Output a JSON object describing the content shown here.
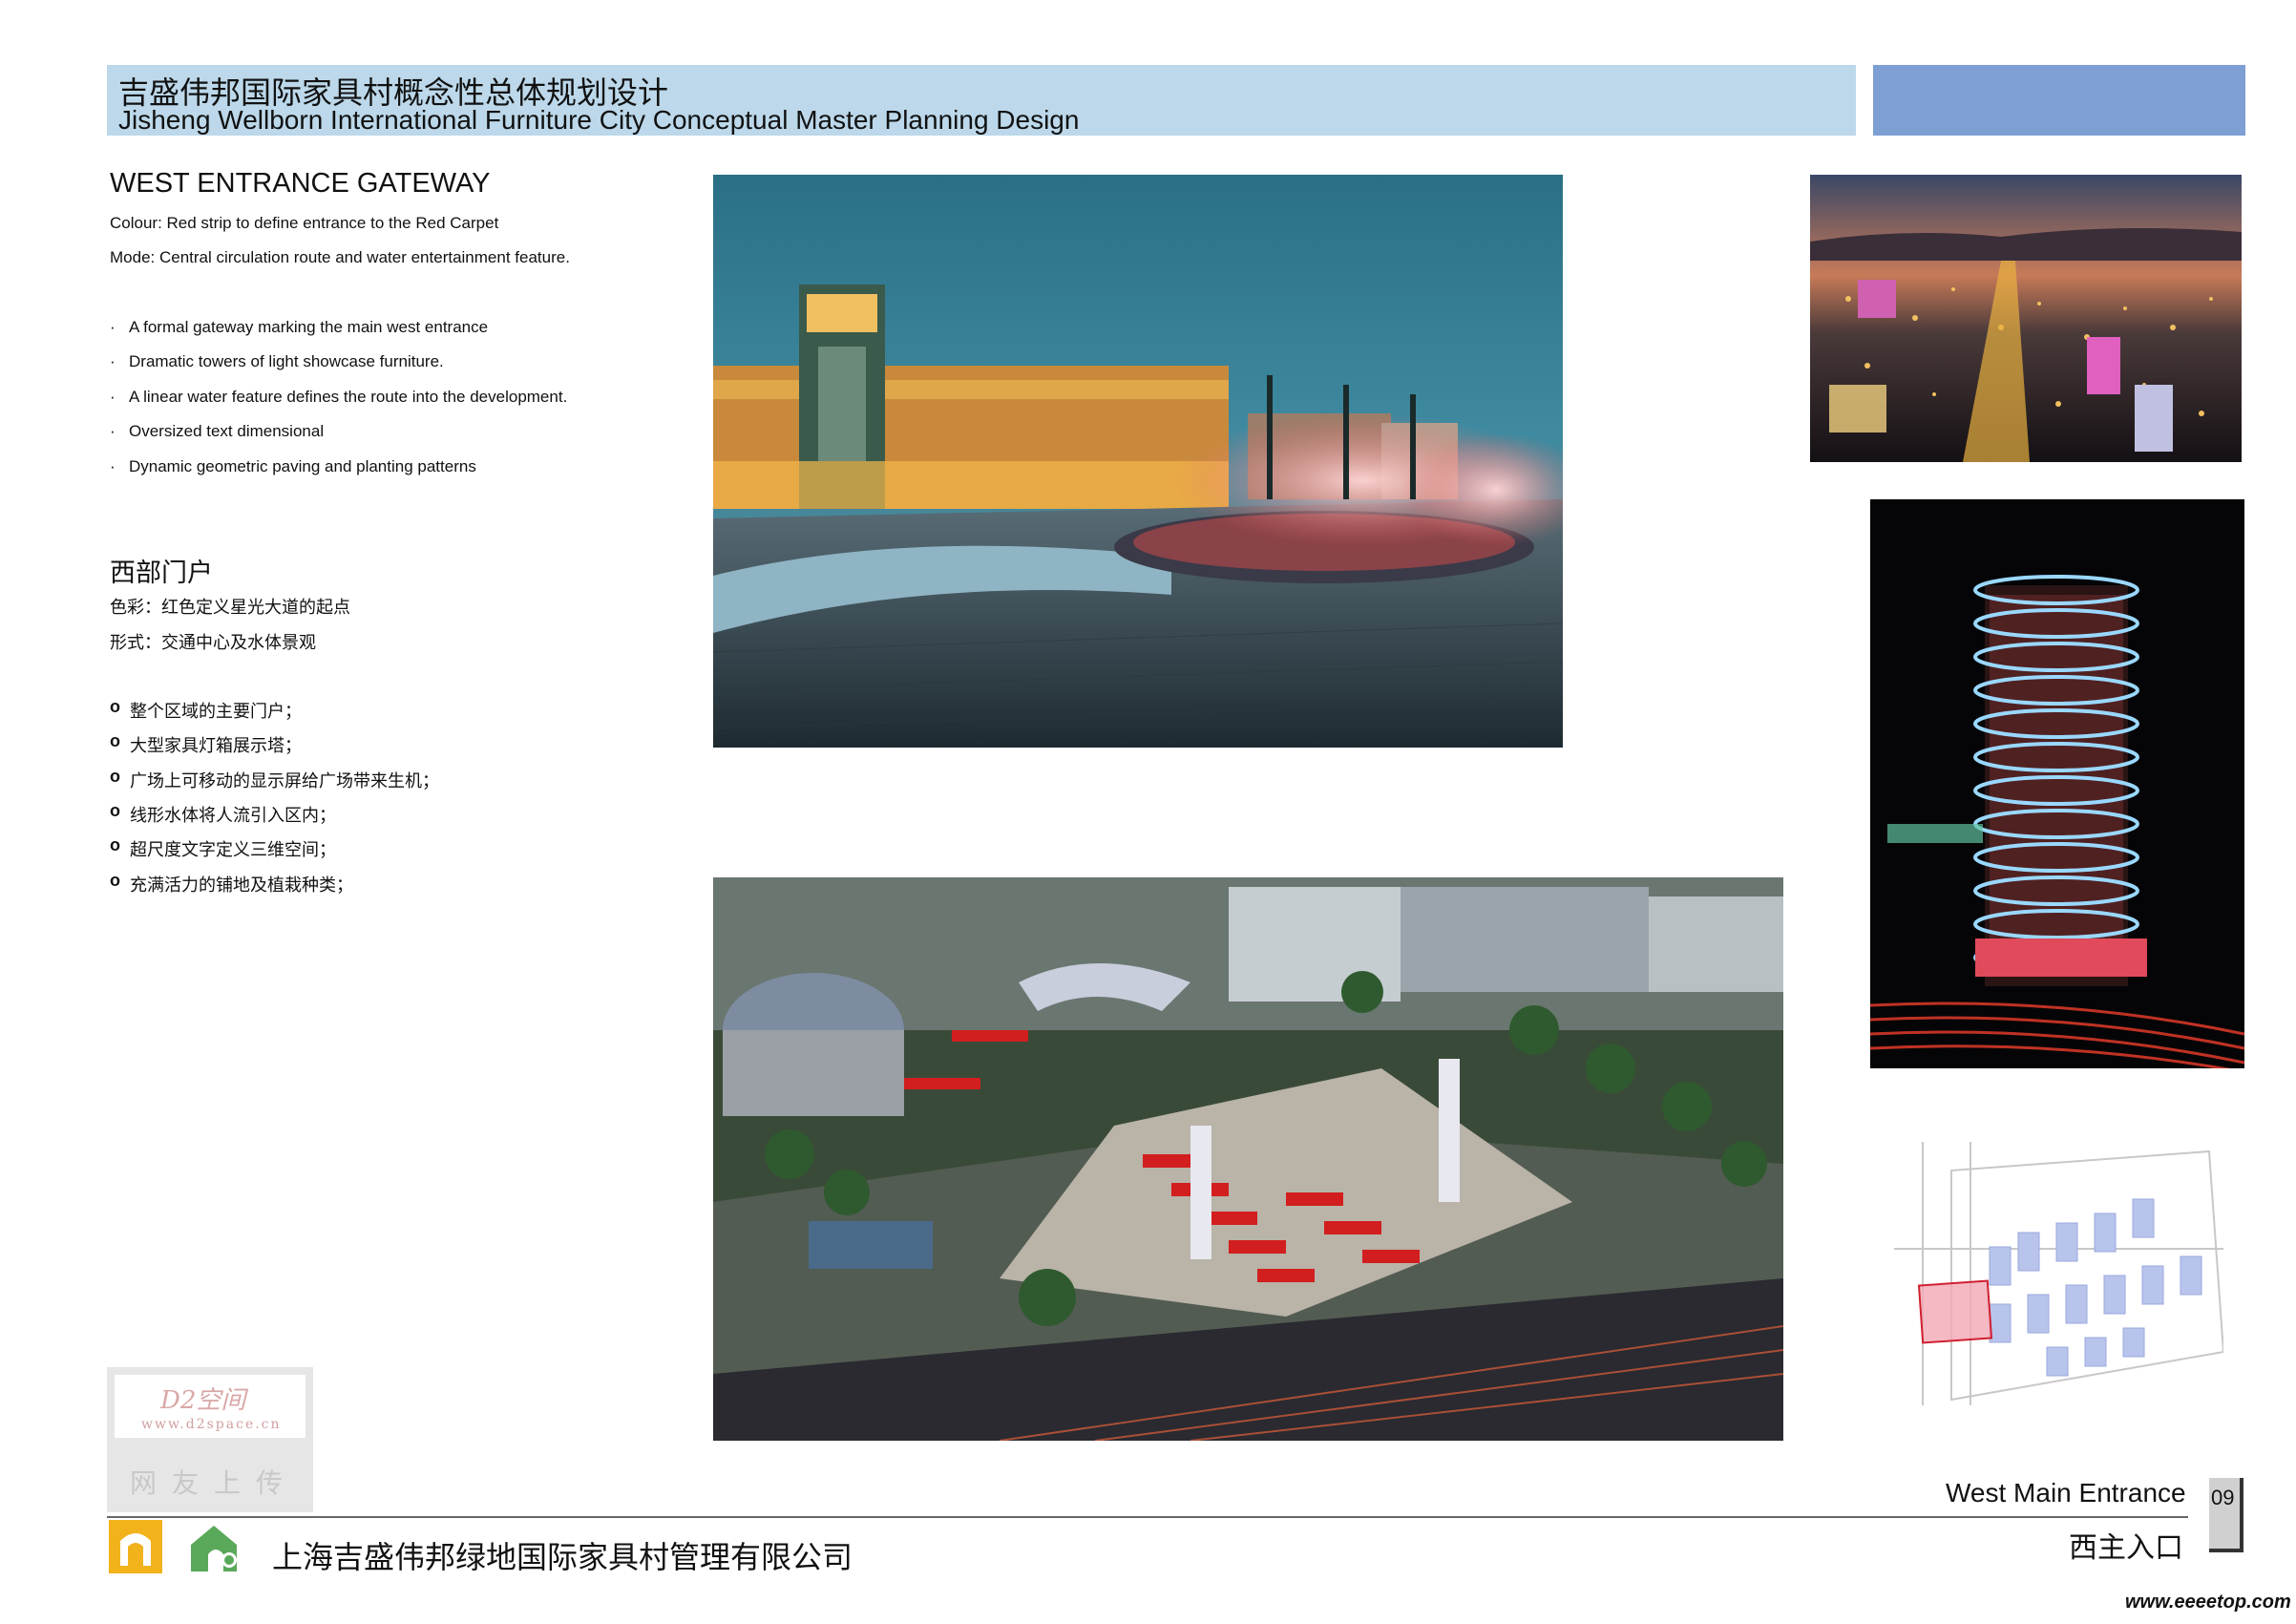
{
  "header": {
    "title_cn": "吉盛伟邦国际家具村概念性总体规划设计",
    "title_en": "Jisheng Wellborn International Furniture City Conceptual Master Planning Design"
  },
  "english": {
    "title": "WEST ENTRANCE GATEWAY",
    "colour": "Colour:  Red strip to define entrance to the Red Carpet",
    "mode": "Mode: Central circulation route and water entertainment feature.",
    "bullets": [
      "A formal gateway marking the main west entrance",
      "Dramatic towers of light showcase furniture.",
      "A linear water feature defines the route into the development.",
      "Oversized text dimensional",
      "Dynamic geometric paving and planting patterns"
    ]
  },
  "chinese": {
    "title": "西部门户",
    "colour": "色彩：红色定义星光大道的起点",
    "mode": "形式：交通中心及水体景观",
    "bullets": [
      "整个区域的主要门户；",
      "大型家具灯箱展示塔；",
      "广场上可移动的显示屏给广场带来生机；",
      "线形水体将人流引入区内；",
      "超尺度文字定义三维空间；",
      "充满活力的铺地及植栽种类；"
    ]
  },
  "watermark": {
    "logo": "D2空间",
    "url": "www.d2space.cn",
    "caption": "网友上传"
  },
  "footer": {
    "title_en": "West Main Entrance",
    "title_cn": "西主入口",
    "page": "09",
    "company": "上海吉盛伟邦绿地国际家具村管理有限公司",
    "site": "www.eeeetop.com"
  },
  "colors": {
    "header_band": "#bcd8ea",
    "header_block": "#7e9fd4",
    "logo_yellow": "#f2b21c",
    "logo_green": "#5aa85a",
    "site_highlight": "#e06070"
  }
}
